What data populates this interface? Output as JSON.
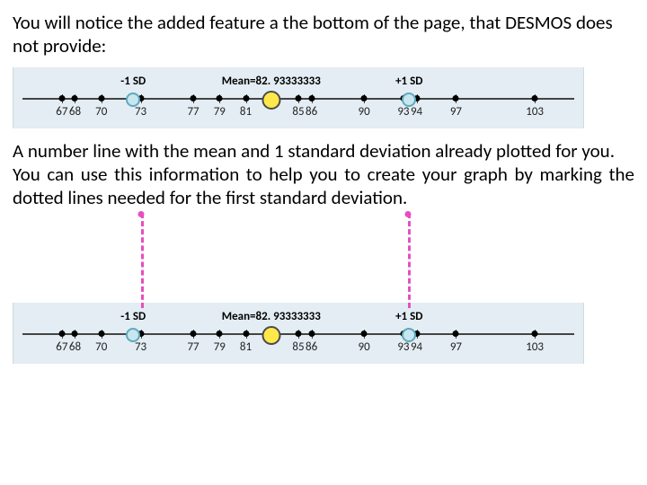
{
  "text": {
    "intro1": "You will notice the added feature a the bottom of the page, that DESMOS does not provide:",
    "intro2": "A number line with the mean and 1 standard deviation already plotted for you.",
    "intro3": "You can use this information to help you to create your graph by marking the dotted lines needed for the first standard deviation."
  },
  "numline": {
    "min": 64,
    "max": 106,
    "mean": 82.93333333,
    "sd": 10.5,
    "ticks": [
      67,
      68,
      70,
      73,
      77,
      79,
      81,
      85,
      86,
      90,
      93,
      94,
      97,
      103
    ],
    "tick_labels": [
      "67",
      "68",
      "70",
      "73",
      "77",
      "79",
      "81",
      "85",
      "86",
      "90",
      "93",
      "94",
      "97",
      "103"
    ],
    "labels": {
      "minus1sd": "-1 SD",
      "mean": "Mean=82. 93333333",
      "plus1sd": "+1 SD"
    }
  },
  "chart_data": {
    "type": "scatter",
    "x": [
      67,
      68,
      70,
      73,
      77,
      79,
      81,
      85,
      86,
      90,
      93,
      94,
      97,
      103
    ],
    "mean": 82.93333333,
    "sd_minus1": 72.43,
    "sd_plus1": 93.43,
    "xlim": [
      64,
      106
    ],
    "title": "",
    "xlabel": "",
    "ylabel": ""
  },
  "dashed_lines_at": [
    72.43,
    93.43
  ]
}
